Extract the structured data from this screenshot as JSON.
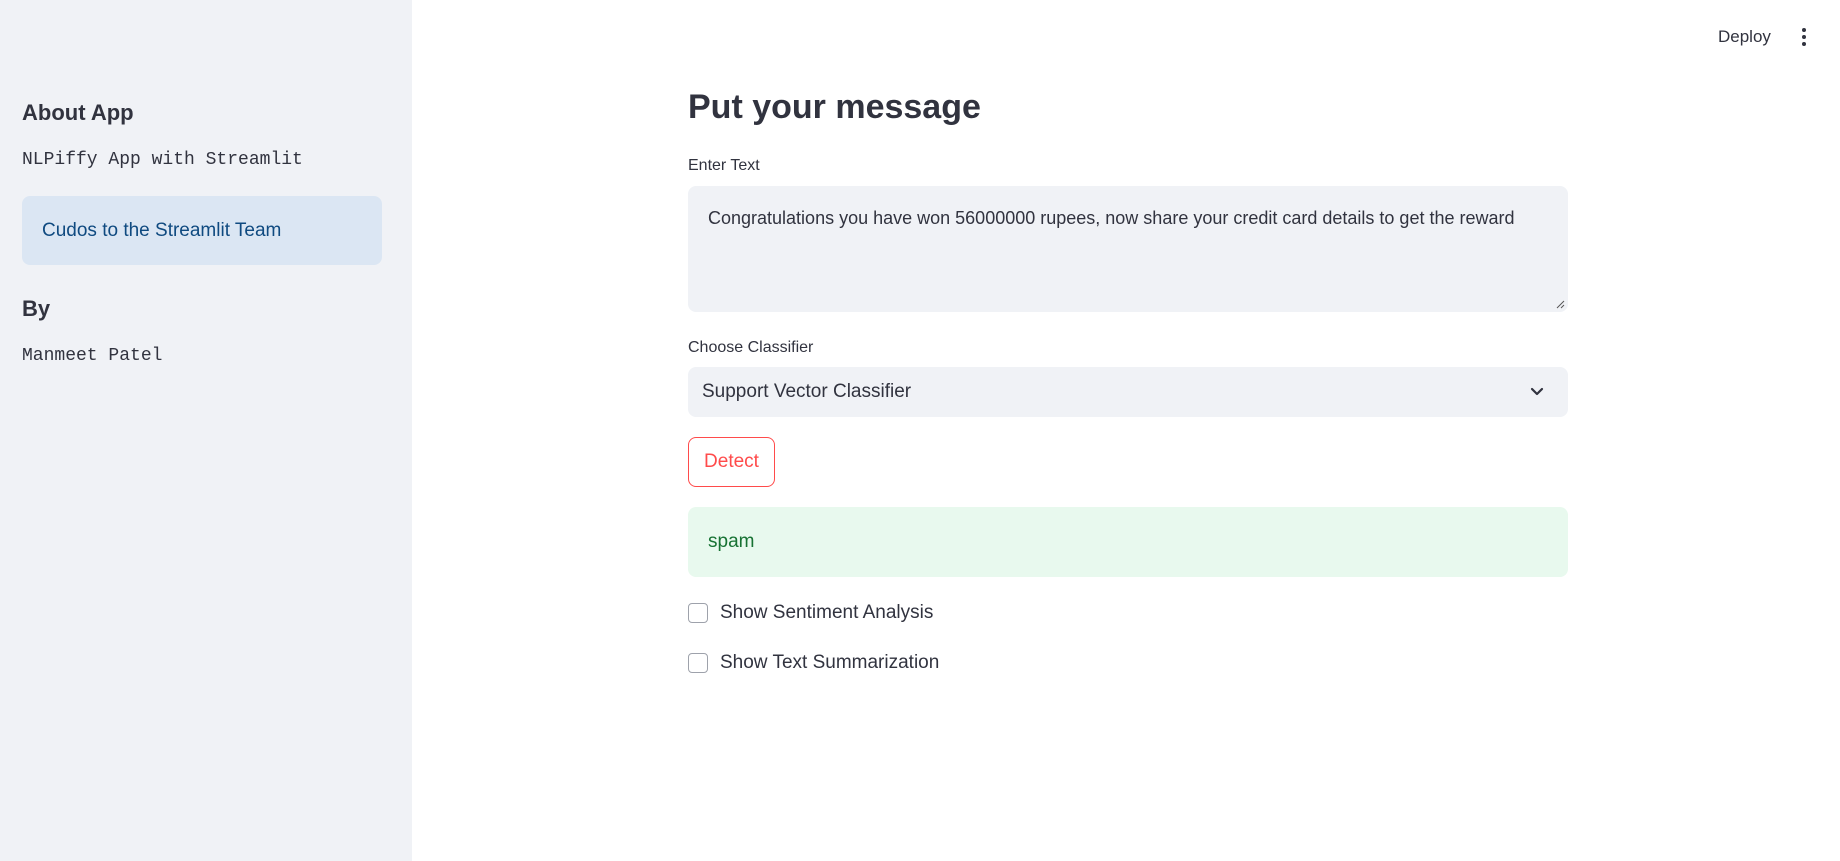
{
  "header": {
    "deploy_label": "Deploy",
    "menu_icon": "vertical-ellipsis-icon"
  },
  "sidebar": {
    "about_heading": "About App",
    "about_text": "NLPiffy App with Streamlit",
    "info_text": "Cudos to the Streamlit Team",
    "by_heading": "By",
    "author": "Manmeet Patel"
  },
  "main": {
    "title": "Put your message",
    "text_input": {
      "label": "Enter Text",
      "value": "Congratulations you have won 56000000 rupees, now share your credit card details to get the reward"
    },
    "classifier": {
      "label": "Choose Classifier",
      "selected": "Support Vector Classifier"
    },
    "detect_label": "Detect",
    "result": "spam",
    "checkboxes": [
      {
        "label": "Show Sentiment Analysis",
        "checked": false
      },
      {
        "label": "Show Text Summarization",
        "checked": false
      }
    ]
  },
  "colors": {
    "sidebar_bg": "#f0f2f6",
    "primary": "#ff4b4b",
    "info_bg": "#dbe6f3",
    "info_text": "#0f4a80",
    "success_bg": "#e8f9ee",
    "success_text": "#177233",
    "text": "#31333f"
  }
}
